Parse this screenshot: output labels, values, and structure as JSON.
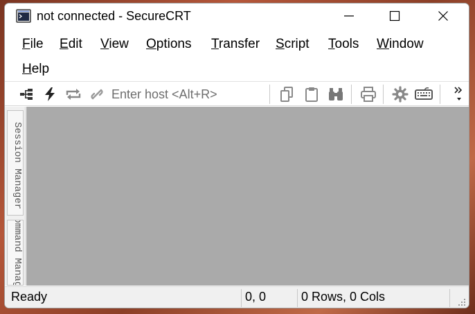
{
  "window": {
    "title": "not connected - SecureCRT"
  },
  "menu": [
    {
      "label": "File"
    },
    {
      "label": "Edit"
    },
    {
      "label": "View"
    },
    {
      "label": "Options"
    },
    {
      "label": "Transfer"
    },
    {
      "label": "Script"
    },
    {
      "label": "Tools"
    },
    {
      "label": "Window"
    },
    {
      "label": "Help"
    }
  ],
  "toolbar": {
    "host_placeholder": "Enter host <Alt+R>",
    "icons": [
      "connect-icon",
      "quick-connect-icon",
      "reconnect-icon",
      "disconnect-icon",
      "copy-icon",
      "paste-icon",
      "find-icon",
      "print-icon",
      "settings-icon",
      "keymap-icon",
      "overflow-icon"
    ],
    "overflow_label": "»"
  },
  "sidebar": {
    "tabs": [
      {
        "label": "Session Manager"
      },
      {
        "label": "Command Manager"
      }
    ]
  },
  "terminal": {
    "background": "#aaaaaa"
  },
  "status": {
    "text": "Ready",
    "position": "0, 0",
    "size": "0 Rows, 0 Cols"
  }
}
